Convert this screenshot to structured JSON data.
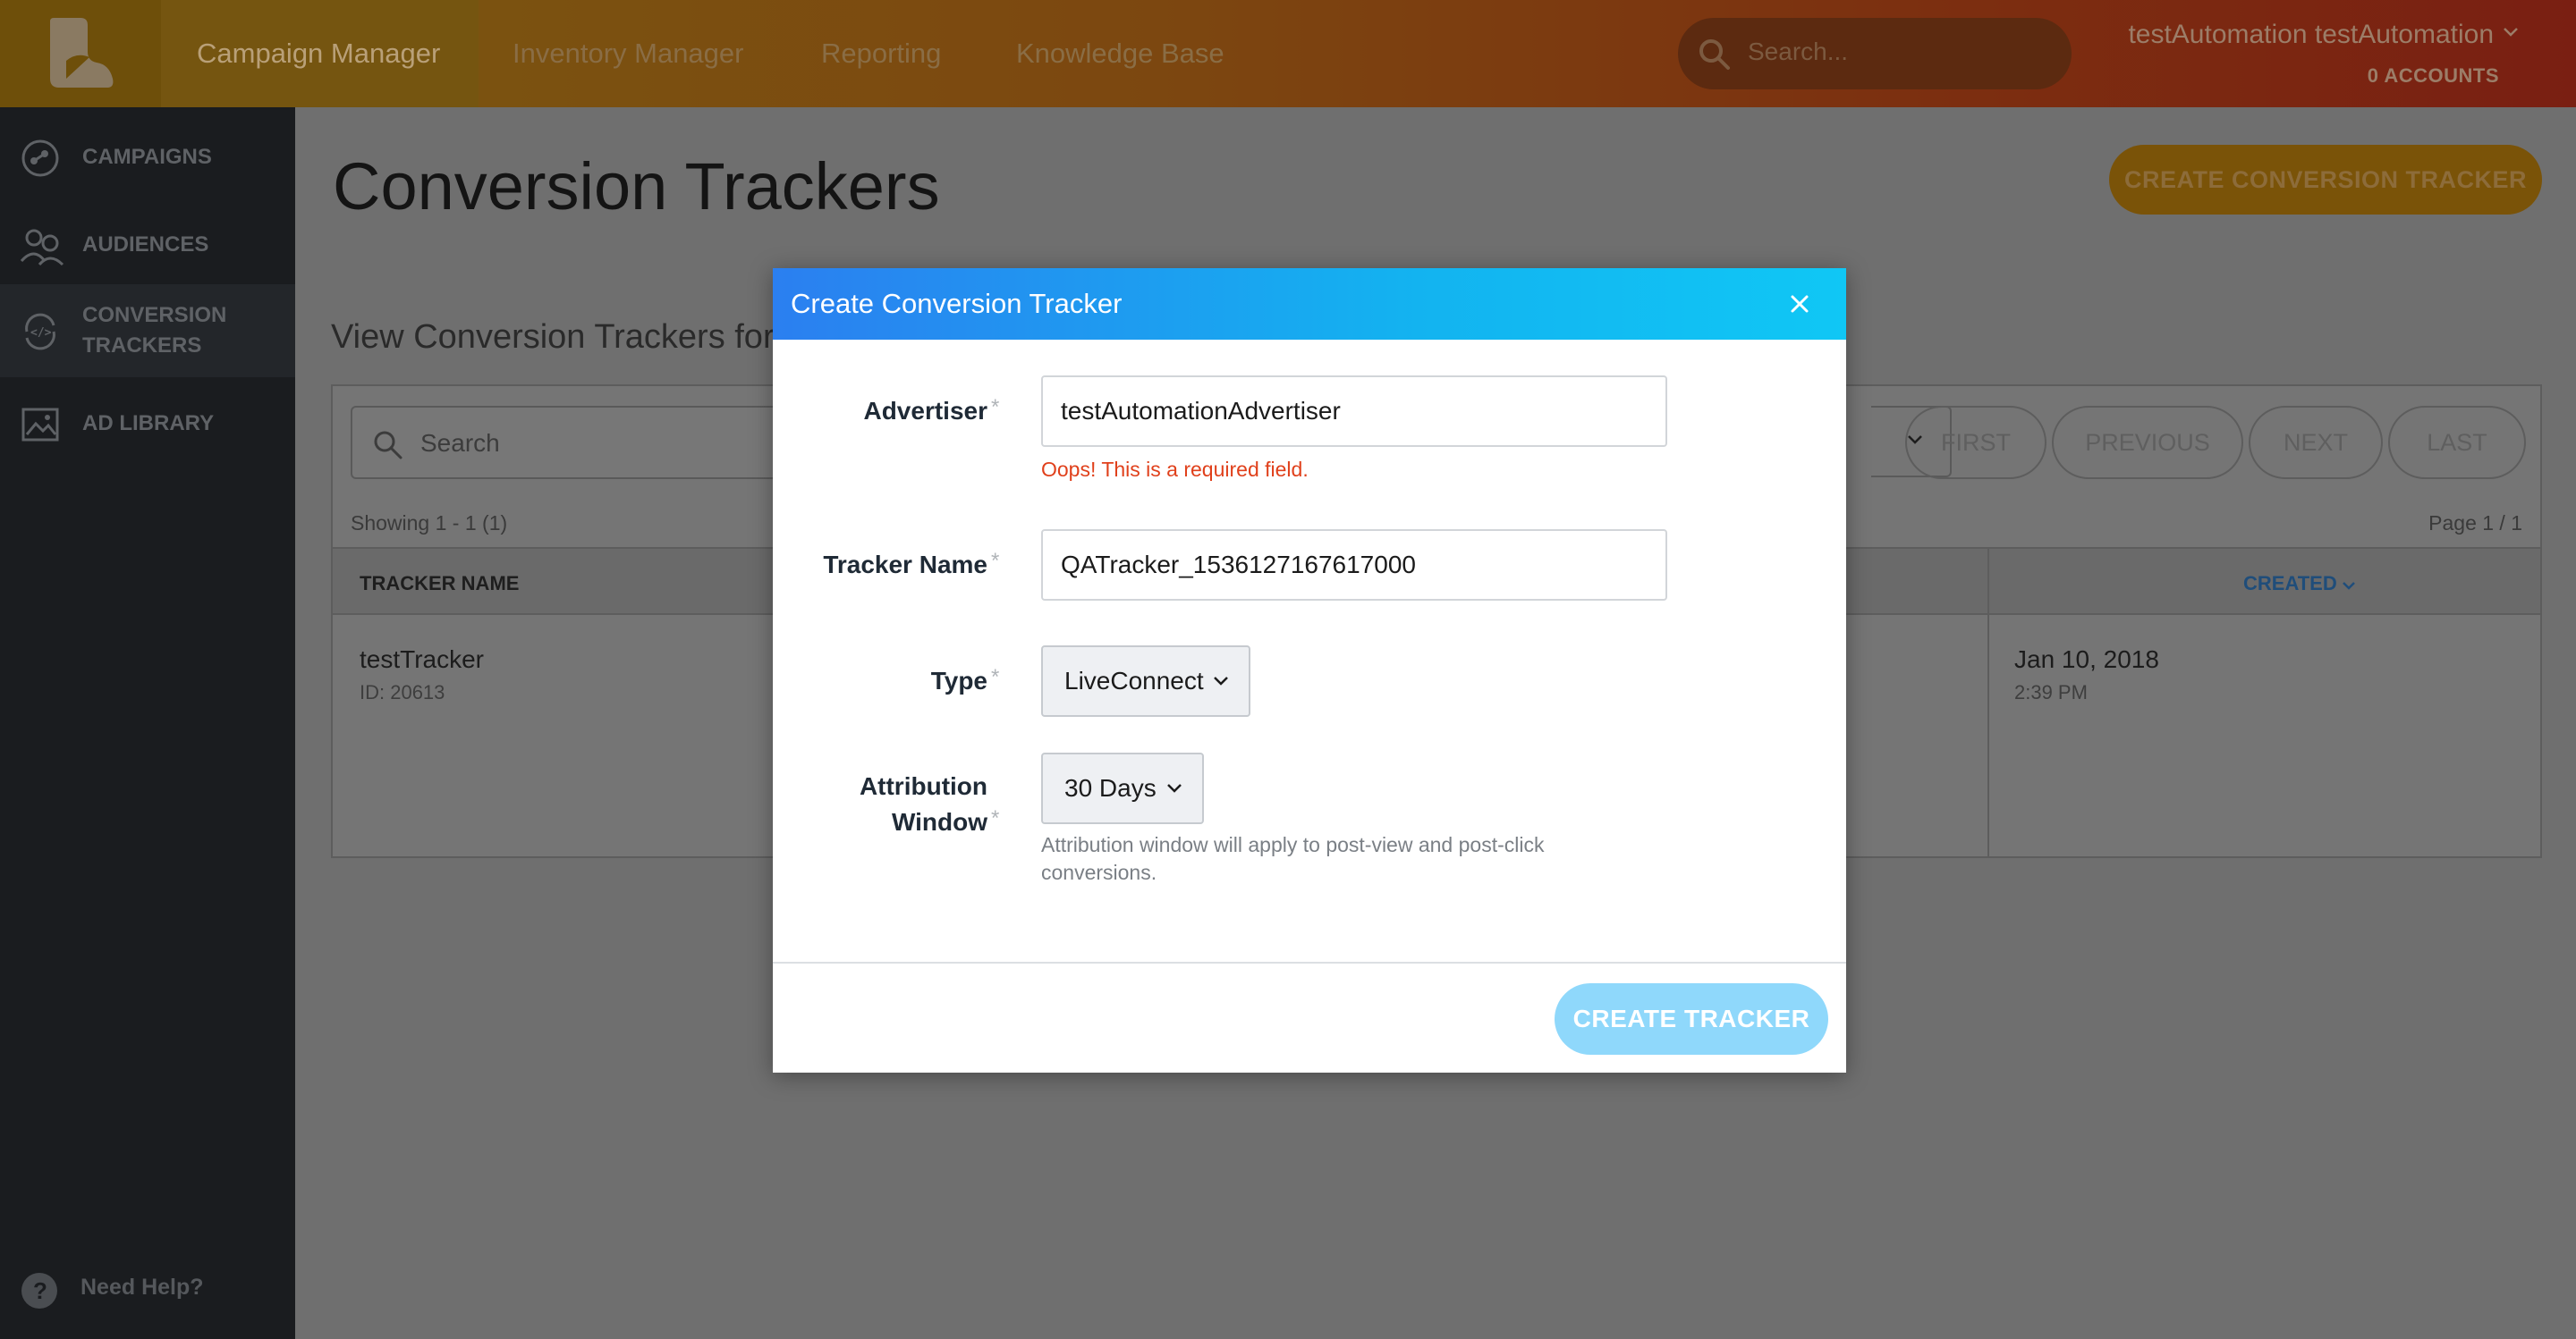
{
  "topbar": {
    "nav": [
      "Campaign Manager",
      "Inventory Manager",
      "Reporting",
      "Knowledge Base"
    ],
    "search_placeholder": "Search...",
    "user_name": "testAutomation testAutomation",
    "accounts": "0 ACCOUNTS"
  },
  "sidebar": {
    "items": [
      {
        "label_1": "CAMPAIGNS",
        "icon": "campaigns-icon"
      },
      {
        "label_1": "AUDIENCES",
        "icon": "audiences-icon"
      },
      {
        "label_1": "CONVERSION",
        "label_2": "TRACKERS",
        "icon": "conversion-trackers-icon"
      },
      {
        "label_1": "AD LIBRARY",
        "icon": "ad-library-icon"
      }
    ],
    "help": "Need Help?"
  },
  "main": {
    "title": "Conversion Trackers",
    "create_button": "CREATE CONVERSION TRACKER",
    "view_for": "View Conversion Trackers for",
    "search_placeholder": "Search",
    "pagination": {
      "first": "FIRST",
      "previous": "PREVIOUS",
      "next": "NEXT",
      "last": "LAST"
    },
    "showing": "Showing 1 - 1 (1)",
    "page_of": "Page 1 / 1",
    "columns": {
      "name": "TRACKER NAME",
      "created": "CREATED"
    },
    "rows": [
      {
        "name": "testTracker",
        "id": "ID: 20613",
        "date": "Jan 10, 2018",
        "time": "2:39 PM"
      }
    ]
  },
  "modal": {
    "title": "Create Conversion Tracker",
    "advertiser_label": "Advertiser",
    "advertiser_value": "testAutomationAdvertiser",
    "advertiser_error": "Oops! This is a required field.",
    "tracker_name_label": "Tracker Name",
    "tracker_name_value": "QATracker_1536127167617000",
    "type_label": "Type",
    "type_value": "LiveConnect",
    "attribution_label_1": "Attribution",
    "attribution_label_2": "Window",
    "attribution_value": "30 Days",
    "attribution_help": "Attribution window will apply to post-view and post-click conversions.",
    "required_mark": "*",
    "submit_button": "CREATE TRACKER"
  },
  "colors": {
    "modal_header_start": "#2b7ff0",
    "modal_header_end": "#10c7f5",
    "error": "#e0401b",
    "submit_disabled": "#8fd8fb",
    "brand_orange": "#e8a000"
  }
}
